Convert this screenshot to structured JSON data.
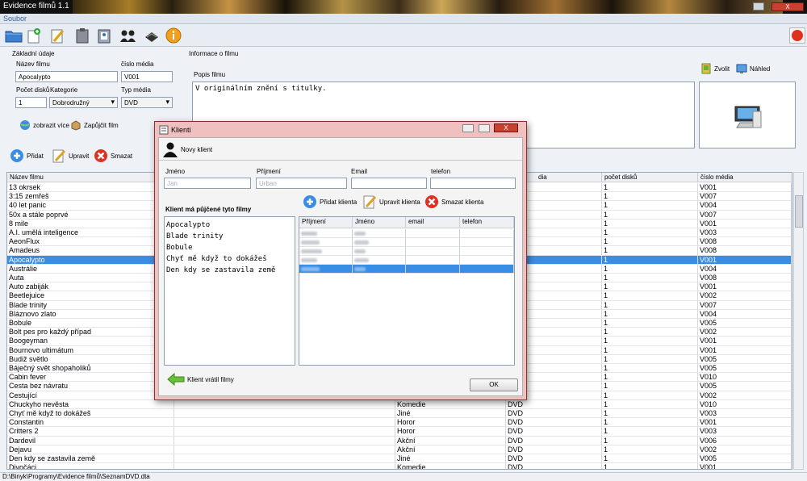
{
  "window": {
    "title": "Evidence filmů 1.1",
    "close_label": "X"
  },
  "menu": {
    "items": [
      "Soubor"
    ]
  },
  "toolbar": {
    "icons": [
      "folder-icon",
      "new-document-icon",
      "edit-document-icon",
      "clipboard-icon",
      "clipboard-user-icon",
      "users-icon",
      "disk-icon",
      "info-icon"
    ],
    "power_icon": "power-icon"
  },
  "basic": {
    "section_label": "Základní údaje",
    "name_label": "Název filmu",
    "name_value": "Apocalypto",
    "media_no_label": "číslo média",
    "media_no_value": "V001",
    "discs_label": "Počet disků",
    "discs_value": "1",
    "category_label": "Kategorie",
    "category_value": "Dobrodružný",
    "media_type_label": "Typ média",
    "media_type_value": "DVD",
    "show_more": "zobrazit více",
    "lend": "Zapůjčit film"
  },
  "info": {
    "section_label": "Informace o filmu",
    "desc_label": "Popis filmu",
    "desc_value": "V originálním znění s titulky.",
    "choose": "Zvolit",
    "preview": "Náhled"
  },
  "actions": {
    "add": "Přidat",
    "edit": "Upravit",
    "delete": "Smazat"
  },
  "table": {
    "headers": [
      "Název filmu",
      "",
      "",
      "",
      "počet disků",
      "číslo média"
    ],
    "header_media": "dia",
    "rows": [
      [
        "13 okrsek",
        "",
        "",
        "1",
        "V001"
      ],
      [
        "3:15 zemřeš",
        "",
        "",
        "1",
        "V007"
      ],
      [
        "40 let panic",
        "",
        "",
        "1",
        "V004"
      ],
      [
        "50x a stále poprvé",
        "",
        "",
        "1",
        "V007"
      ],
      [
        "8 mile",
        "",
        "",
        "1",
        "V001"
      ],
      [
        "A.I. umělá inteligence",
        "",
        "",
        "1",
        "V003"
      ],
      [
        "AeonFlux",
        "",
        "",
        "1",
        "V008"
      ],
      [
        "Amadeus",
        "",
        "",
        "1",
        "V008"
      ],
      [
        "Apocalypto",
        "",
        "",
        "1",
        "V001"
      ],
      [
        "Austrálie",
        "",
        "",
        "1",
        "V004"
      ],
      [
        "Auta",
        "",
        "",
        "1",
        "V008"
      ],
      [
        "Auto zabiják",
        "",
        "",
        "1",
        "V001"
      ],
      [
        "Beetlejuice",
        "",
        "",
        "1",
        "V002"
      ],
      [
        "Blade trinity",
        "",
        "",
        "1",
        "V007"
      ],
      [
        "Bláznovo zlato",
        "",
        "",
        "1",
        "V004"
      ],
      [
        "Bobule",
        "",
        "",
        "1",
        "V005"
      ],
      [
        "Bolt pes pro každý případ",
        "",
        "",
        "1",
        "V002"
      ],
      [
        "Boogeyman",
        "",
        "",
        "1",
        "V001"
      ],
      [
        "Bournovo ultimátum",
        "",
        "",
        "1",
        "V001"
      ],
      [
        "Budiž světlo",
        "",
        "",
        "1",
        "V005"
      ],
      [
        "Báječný svět shopaholiků",
        "",
        "",
        "1",
        "V005"
      ],
      [
        "Cabin fever",
        "",
        "",
        "1",
        "V010"
      ],
      [
        "Cesta bez návratu",
        "",
        "",
        "1",
        "V005"
      ],
      [
        "Cestující",
        "",
        "",
        "1",
        "V002"
      ],
      [
        "Chuckyho nevěsta",
        "Komedie",
        "DVD",
        "1",
        "V010"
      ],
      [
        "Chyť mě když to dokážeš",
        "Jiné",
        "DVD",
        "1",
        "V003"
      ],
      [
        "Constantin",
        "Horor",
        "DVD",
        "1",
        "V001"
      ],
      [
        "Critters 2",
        "Horor",
        "DVD",
        "1",
        "V003"
      ],
      [
        "Dardevil",
        "Akční",
        "DVD",
        "1",
        "V006"
      ],
      [
        "Dejavu",
        "Akční",
        "DVD",
        "1",
        "V002"
      ],
      [
        "Den kdy se zastavila země",
        "Jiné",
        "DVD",
        "1",
        "V005"
      ],
      [
        "Divočáci",
        "Komedie",
        "DVD",
        "1",
        "V001"
      ]
    ]
  },
  "status": {
    "path": "D:\\Binyk\\Programy\\Evidence filmů\\SeznamDVD.dta"
  },
  "dialog": {
    "title": "Klienti",
    "new_client": "Novy klient",
    "first_name_label": "Jméno",
    "last_name_label": "Příjmení",
    "email_label": "Email",
    "phone_label": "telefon",
    "first_name_value": "Jan",
    "last_name_value": "Urban",
    "borrowed_label": "Klient má půjčené tyto filmy",
    "borrowed": [
      "Apocalypto",
      "Blade trinity",
      "Bobule",
      "Chyť mě když to dokážeš",
      "Den kdy se zastavila země"
    ],
    "add_client": "Přidat klienta",
    "edit_client": "Upravit klienta",
    "delete_client": "Smazat klienta",
    "client_headers": [
      "Příjmení",
      "Jméno",
      "email",
      "telefon"
    ],
    "returned": "Klient vrátil filmy",
    "ok": "OK"
  },
  "colors": {
    "selection": "#3a8de4",
    "dialog_frame": "#f0c0c0"
  }
}
